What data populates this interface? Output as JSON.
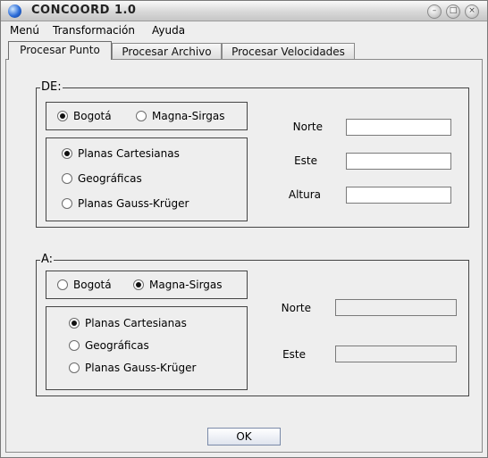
{
  "window": {
    "title": "CONCOORD 1.0"
  },
  "menubar": {
    "items": [
      {
        "label": "Menú"
      },
      {
        "label": "Transformación"
      },
      {
        "label": "Ayuda"
      }
    ]
  },
  "tabs": [
    {
      "label": "Procesar Punto",
      "active": true
    },
    {
      "label": "Procesar Archivo",
      "active": false
    },
    {
      "label": "Procesar Velocidades",
      "active": false
    }
  ],
  "origin": {
    "title": "DE:",
    "datum_options": [
      {
        "label": "Bogotá",
        "selected": true
      },
      {
        "label": "Magna-Sirgas",
        "selected": false
      }
    ],
    "coord_options": [
      {
        "label": "Planas Cartesianas",
        "selected": true
      },
      {
        "label": "Geográficas",
        "selected": false
      },
      {
        "label": "Planas Gauss-Krüger",
        "selected": false
      }
    ],
    "fields": [
      {
        "label": "Norte",
        "value": ""
      },
      {
        "label": "Este",
        "value": ""
      },
      {
        "label": "Altura",
        "value": ""
      }
    ]
  },
  "target": {
    "title": "A:",
    "datum_options": [
      {
        "label": "Bogotá",
        "selected": false
      },
      {
        "label": "Magna-Sirgas",
        "selected": true
      }
    ],
    "coord_options": [
      {
        "label": "Planas Cartesianas",
        "selected": true
      },
      {
        "label": "Geográficas",
        "selected": false
      },
      {
        "label": "Planas Gauss-Krüger",
        "selected": false
      }
    ],
    "fields": [
      {
        "label": "Norte",
        "value": ""
      },
      {
        "label": "Este",
        "value": ""
      }
    ]
  },
  "ok_label": "OK",
  "icons": {
    "app": "globe-icon",
    "minimize": "minimize-icon",
    "maximize": "maximize-icon",
    "close": "close-icon"
  },
  "colors": {
    "window_bg": "#eeeeee",
    "button_border": "#7a8aa8"
  }
}
